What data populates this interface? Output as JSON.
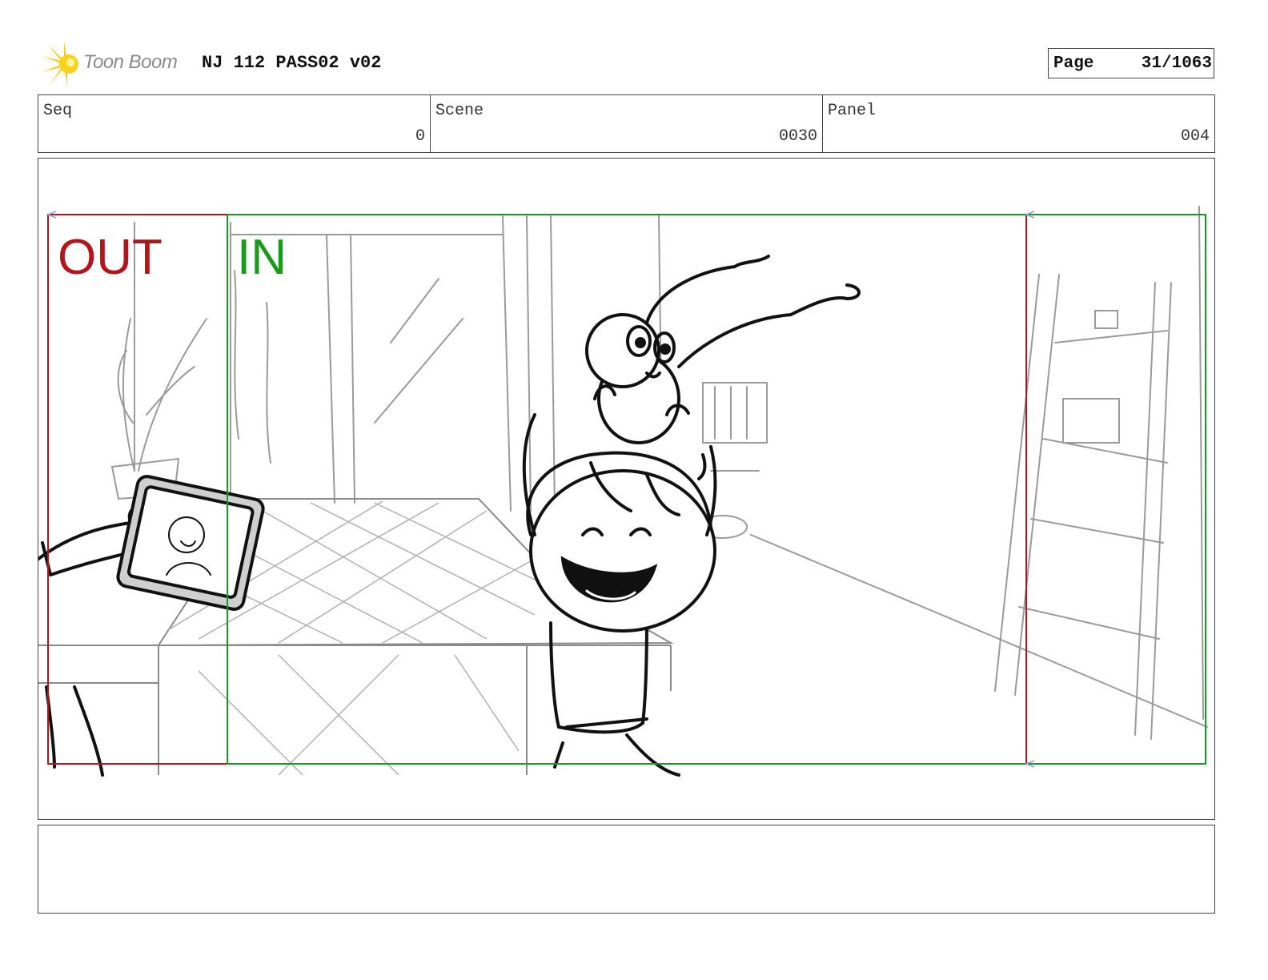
{
  "header": {
    "logo_text": "Toon Boom",
    "title": "NJ 112 PASS02 v02",
    "page_label": "Page",
    "page_number": "31/1063"
  },
  "info": {
    "seq_label": "Seq",
    "seq_value": "0",
    "scene_label": "Scene",
    "scene_value": "0030",
    "panel_label": "Panel",
    "panel_value": "004"
  },
  "panel": {
    "out_label": "OUT",
    "in_label": "IN",
    "out_color": "#b0161c",
    "in_color": "#1a9a1a"
  },
  "notes": {
    "text": ""
  }
}
